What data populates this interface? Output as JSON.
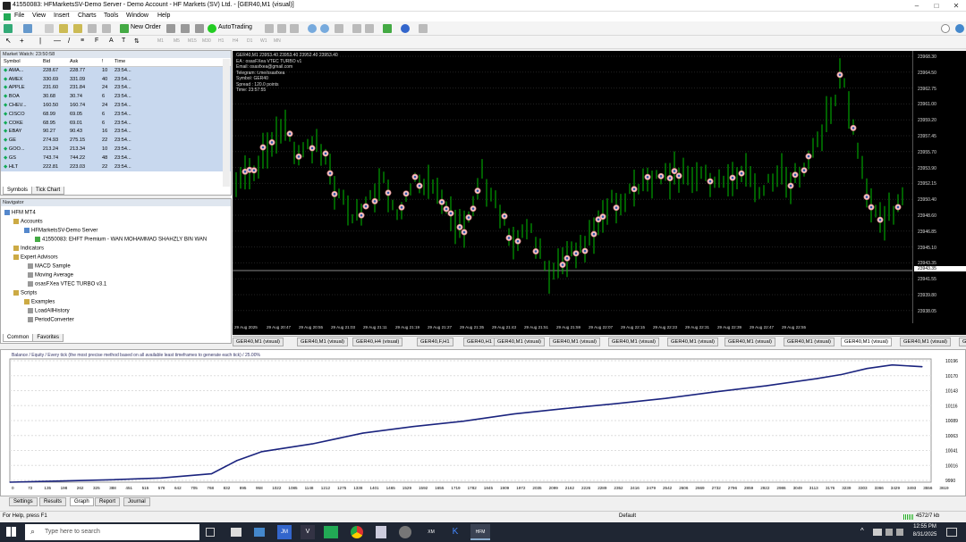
{
  "window": {
    "title": "41550083: HFMarketsSV-Demo Server - Demo Account - HF Markets (SV) Ltd. - [GER40,M1 (visual)]",
    "minimize": "–",
    "maximize": "□",
    "close": "✕"
  },
  "menu": [
    "File",
    "View",
    "Insert",
    "Charts",
    "Tools",
    "Window",
    "Help"
  ],
  "toolbar": {
    "new_order": "New Order",
    "autotrading": "AutoTrading"
  },
  "timeframes": [
    "M1",
    "M5",
    "M15",
    "M30",
    "H1",
    "H4",
    "D1",
    "W1",
    "MN"
  ],
  "market_watch": {
    "title": "Market Watch: 23:50:58",
    "columns": [
      "Symbol",
      "Bid",
      "Ask",
      "!",
      "Time"
    ],
    "rows": [
      [
        "AMA...",
        "228.67",
        "228.77",
        "10",
        "23:54..."
      ],
      [
        "AMEX",
        "330.69",
        "331.09",
        "40",
        "23:54..."
      ],
      [
        "APPLE",
        "231.60",
        "231.84",
        "24",
        "23:54..."
      ],
      [
        "BOA",
        "30.68",
        "30.74",
        "6",
        "23:54..."
      ],
      [
        "CHEV...",
        "160.50",
        "160.74",
        "24",
        "23:54..."
      ],
      [
        "CISCO",
        "68.99",
        "69.05",
        "6",
        "23:54..."
      ],
      [
        "COKE",
        "68.95",
        "69.01",
        "6",
        "23:54..."
      ],
      [
        "EBAY",
        "90.27",
        "90.43",
        "16",
        "23:54..."
      ],
      [
        "GE",
        "274.93",
        "275.15",
        "22",
        "23:54..."
      ],
      [
        "GOO...",
        "213.24",
        "213.34",
        "10",
        "23:54..."
      ],
      [
        "GS",
        "743.74",
        "744.22",
        "48",
        "23:54..."
      ],
      [
        "HLT",
        "222.81",
        "223.03",
        "22",
        "23:54..."
      ]
    ],
    "tabs": [
      "Symbols",
      "Tick Chart"
    ]
  },
  "navigator": {
    "title": "Navigator",
    "root": "HFM MT4",
    "accounts": "Accounts",
    "server": "HFMarketsSV-Demo Server",
    "account": "41550083: EHFT Premium - WAN MOHAMMAD SHAHZLY BIN WAN",
    "indicators": "Indicators",
    "experts": "Expert Advisors",
    "ea_items": [
      "MACD Sample",
      "Moving Average",
      "osasFXea VTEC TURBO v3.1"
    ],
    "scripts": "Scripts",
    "script_items": [
      "Examples",
      "LoadAllHistory",
      "PeriodConverter"
    ],
    "tabs": [
      "Common",
      "Favorites"
    ]
  },
  "chart": {
    "header": "GER40,M1  23953.40 23953.40 23952.40 23953.40",
    "info_lines": [
      "EA : osasFXea VTEC TURBO v1",
      "Email: osasfxea@gmail.com",
      "Telegram: t.me/osasfxea",
      "Symbol: GER40",
      "Spread : 120.0 points",
      "Time: 23:57:55"
    ],
    "price_labels": [
      "23968.30",
      "23964.50",
      "23962.75",
      "23961.00",
      "23959.20",
      "23957.45",
      "23955.70",
      "23953.90",
      "23952.15",
      "23950.40",
      "23948.60",
      "23946.85",
      "23945.10",
      "23943.35",
      "23941.55",
      "23939.80",
      "23938.05"
    ],
    "current_price": "23943.35",
    "time_labels": [
      "29 Aug 2025",
      "29 Aug 20:47",
      "29 Aug 20:55",
      "29 Aug 21:03",
      "29 Aug 21:11",
      "29 Aug 21:19",
      "29 Aug 21:27",
      "29 Aug 21:35",
      "29 Aug 21:43",
      "29 Aug 21:51",
      "29 Aug 21:59",
      "29 Aug 22:07",
      "29 Aug 22:15",
      "29 Aug 22:23",
      "29 Aug 22:31",
      "29 Aug 22:39",
      "29 Aug 22:47",
      "29 Aug 22:55"
    ],
    "colors": {
      "background": "#000000",
      "bull": "#00c000",
      "bear": "#00c000",
      "grid": "#333333"
    }
  },
  "chart_tabs": [
    "GER40,M1 (visual)",
    "GER40,M1 (visual)",
    "GER40,H4 (visual)",
    "GER40,F,H1",
    "GER40,H1",
    "GER40,M1 (visual)",
    "GER40,M1 (visual)",
    "GER40,M1 (visual)",
    "GER40,M1 (visual)",
    "GER40,M1 (visual)",
    "GER40,M1 (visual)",
    "GER40,M1 (visual)",
    "GER40,M1 (visual)",
    "GER40,M1 (visual)",
    "GER40,M1 (visual)"
  ],
  "tester": {
    "legend": "Balance / Equity / Every tick (the most precise method based on all available least timeframes to generate each tick) / 25.00%",
    "y_labels": [
      "10196",
      "10170",
      "10143",
      "10116",
      "10089",
      "10063",
      "10041",
      "10016",
      "9990"
    ],
    "x_labels": [
      "0",
      "72",
      "135",
      "198",
      "262",
      "325",
      "388",
      "451",
      "515",
      "578",
      "642",
      "705",
      "768",
      "832",
      "895",
      "958",
      "1022",
      "1085",
      "1148",
      "1212",
      "1275",
      "1338",
      "1401",
      "1465",
      "1529",
      "1592",
      "1655",
      "1719",
      "1782",
      "1845",
      "1909",
      "1972",
      "2035",
      "2099",
      "2162",
      "2226",
      "2289",
      "2352",
      "2416",
      "2479",
      "2542",
      "2606",
      "2669",
      "2732",
      "2796",
      "2859",
      "2922",
      "2986",
      "3049",
      "3113",
      "3176",
      "3239",
      "3303",
      "3366",
      "3429",
      "3493",
      "3556",
      "3619"
    ],
    "tabs": [
      "Settings",
      "Results",
      "Graph",
      "Report",
      "Journal"
    ]
  },
  "chart_data": {
    "type": "line",
    "series": [
      {
        "name": "Balance",
        "x": [
          0,
          200,
          400,
          600,
          800,
          900,
          1000,
          1200,
          1400,
          1600,
          1800,
          2000,
          2200,
          2400,
          2600,
          2800,
          3000,
          3200,
          3300,
          3400,
          3500,
          3619
        ],
        "values": [
          9990,
          9992,
          9994,
          9997,
          10004,
          10026,
          10041,
          10054,
          10072,
          10083,
          10092,
          10104,
          10113,
          10121,
          10130,
          10141,
          10151,
          10163,
          10170,
          10180,
          10186,
          10183
        ]
      }
    ],
    "ylim": [
      9990,
      10196
    ]
  },
  "status": {
    "help": "For Help, press F1",
    "profile": "Default",
    "traffic": "4572/7 kb"
  },
  "taskbar": {
    "search_placeholder": "Type here to search",
    "time": "12:55 PM",
    "date": "8/31/2025"
  }
}
